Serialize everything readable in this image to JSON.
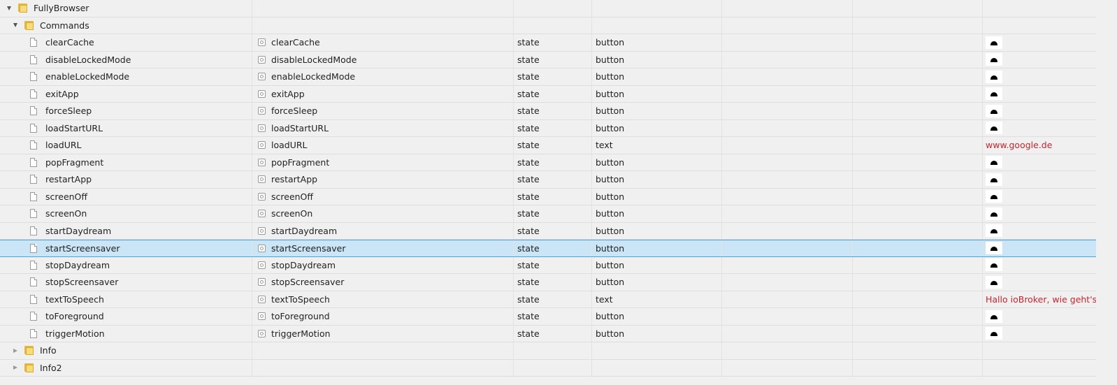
{
  "tree": {
    "root": {
      "label": "FullyBrowser",
      "expanded": true
    },
    "commands_folder": {
      "label": "Commands",
      "expanded": true
    },
    "items": [
      {
        "name": "clearCache",
        "id": "clearCache",
        "role": "state",
        "type": "button",
        "value": "button-icon"
      },
      {
        "name": "disableLockedMode",
        "id": "disableLockedMode",
        "role": "state",
        "type": "button",
        "value": "button-icon"
      },
      {
        "name": "enableLockedMode",
        "id": "enableLockedMode",
        "role": "state",
        "type": "button",
        "value": "button-icon"
      },
      {
        "name": "exitApp",
        "id": "exitApp",
        "role": "state",
        "type": "button",
        "value": "button-icon"
      },
      {
        "name": "forceSleep",
        "id": "forceSleep",
        "role": "state",
        "type": "button",
        "value": "button-icon"
      },
      {
        "name": "loadStartURL",
        "id": "loadStartURL",
        "role": "state",
        "type": "button",
        "value": "button-icon"
      },
      {
        "name": "loadURL",
        "id": "loadURL",
        "role": "state",
        "type": "text",
        "value": "www.google.de"
      },
      {
        "name": "popFragment",
        "id": "popFragment",
        "role": "state",
        "type": "button",
        "value": "button-icon"
      },
      {
        "name": "restartApp",
        "id": "restartApp",
        "role": "state",
        "type": "button",
        "value": "button-icon"
      },
      {
        "name": "screenOff",
        "id": "screenOff",
        "role": "state",
        "type": "button",
        "value": "button-icon"
      },
      {
        "name": "screenOn",
        "id": "screenOn",
        "role": "state",
        "type": "button",
        "value": "button-icon"
      },
      {
        "name": "startDaydream",
        "id": "startDaydream",
        "role": "state",
        "type": "button",
        "value": "button-icon"
      },
      {
        "name": "startScreensaver",
        "id": "startScreensaver",
        "role": "state",
        "type": "button",
        "value": "button-icon",
        "selected": true
      },
      {
        "name": "stopDaydream",
        "id": "stopDaydream",
        "role": "state",
        "type": "button",
        "value": "button-icon"
      },
      {
        "name": "stopScreensaver",
        "id": "stopScreensaver",
        "role": "state",
        "type": "button",
        "value": "button-icon"
      },
      {
        "name": "textToSpeech",
        "id": "textToSpeech",
        "role": "state",
        "type": "text",
        "value": "Hallo ioBroker, wie geht's?"
      },
      {
        "name": "toForeground",
        "id": "toForeground",
        "role": "state",
        "type": "button",
        "value": "button-icon"
      },
      {
        "name": "triggerMotion",
        "id": "triggerMotion",
        "role": "state",
        "type": "button",
        "value": "button-icon"
      }
    ],
    "collapsed_folders": [
      {
        "label": "Info",
        "expanded": false
      },
      {
        "label": "Info2",
        "expanded": false
      }
    ]
  },
  "colors": {
    "selected_row": "#c9e5f6",
    "selected_border": "#4aa3df",
    "value_text": "#c4262e",
    "folder": "#e6b93d"
  },
  "icons": {
    "folder": "folder-icon",
    "object": "document-icon",
    "state": "state-icon",
    "button_value": "button-icon",
    "expanded": "triangle-down-icon",
    "collapsed": "triangle-right-icon"
  }
}
